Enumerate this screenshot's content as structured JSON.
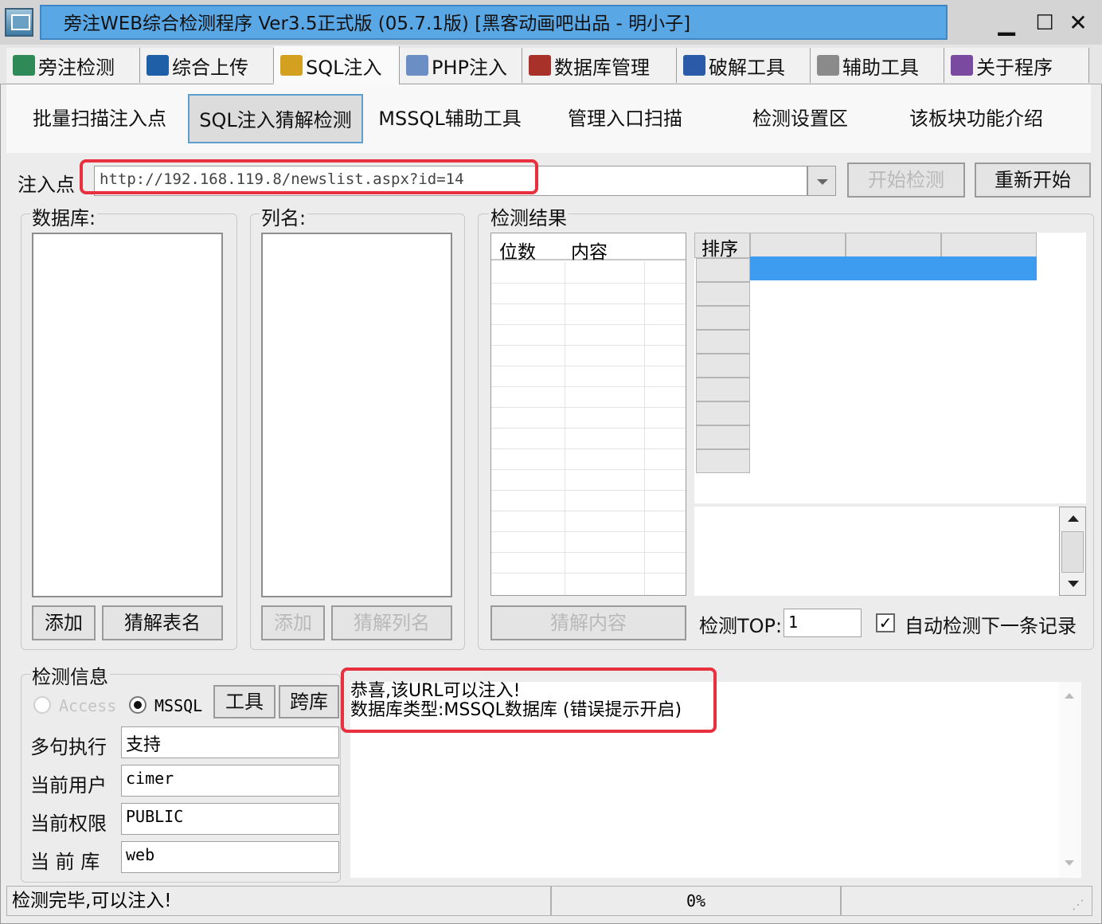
{
  "window": {
    "title": "旁注WEB综合检测程序 Ver3.5正式版 (05.7.1版) [黑客动画吧出品 - 明小子]",
    "minimize": "▁",
    "maximize": "☐",
    "close": "✕"
  },
  "tabs": [
    {
      "label": "旁注检测",
      "icon": "magnifier-globe-icon",
      "color": "#2e8b57"
    },
    {
      "label": "综合上传",
      "icon": "bar-chart-icon",
      "color": "#1f5fa8"
    },
    {
      "label": "SQL注入",
      "icon": "search-doc-icon",
      "color": "#d4a020"
    },
    {
      "label": "PHP注入",
      "icon": "document-icon",
      "color": "#6b8fc4"
    },
    {
      "label": "数据库管理",
      "icon": "database-icon",
      "color": "#a8322a"
    },
    {
      "label": "破解工具",
      "icon": "keyboard-icon",
      "color": "#2a5aa8"
    },
    {
      "label": "辅助工具",
      "icon": "clipboard-icon",
      "color": "#8a8a8a"
    },
    {
      "label": "关于程序",
      "icon": "books-icon",
      "color": "#7a4aa0"
    }
  ],
  "subnav": [
    "批量扫描注入点",
    "SQL注入猜解检测",
    "MSSQL辅助工具",
    "管理入口扫描",
    "检测设置区",
    "该板块功能介绍"
  ],
  "inject": {
    "label": "注入点",
    "url": "http://192.168.119.8/newslist.aspx?id=14",
    "start_btn": "开始检测",
    "restart_btn": "重新开始"
  },
  "database": {
    "label": "数据库:",
    "add_btn": "添加",
    "guess_btn": "猜解表名"
  },
  "columns": {
    "label": "列名:",
    "add_btn": "添加",
    "guess_btn": "猜解列名"
  },
  "results": {
    "label": "检测结果",
    "col_pos": "位数",
    "col_content": "内容",
    "guess_btn": "猜解内容",
    "sort_header": "排序",
    "top_label": "检测TOP:",
    "top_value": "1",
    "auto_next": "自动检测下一条记录",
    "highlight_color": "#3d9cf0"
  },
  "info": {
    "label": "检测信息",
    "radio_access": "Access",
    "radio_mssql": "MSSQL",
    "tool_btn": "工具",
    "cross_btn": "跨库",
    "multi_label": "多句执行",
    "multi_value": "支持",
    "user_label": "当前用户",
    "user_value": "cimer",
    "perm_label": "当前权限",
    "perm_value": "PUBLIC",
    "db_label": "当 前 库",
    "db_value": "web",
    "message_line1": "恭喜,该URL可以注入!",
    "message_line2": "数据库类型:MSSQL数据库 (错误提示开启)"
  },
  "status": {
    "text": "检测完毕,可以注入!",
    "progress": "0%"
  }
}
